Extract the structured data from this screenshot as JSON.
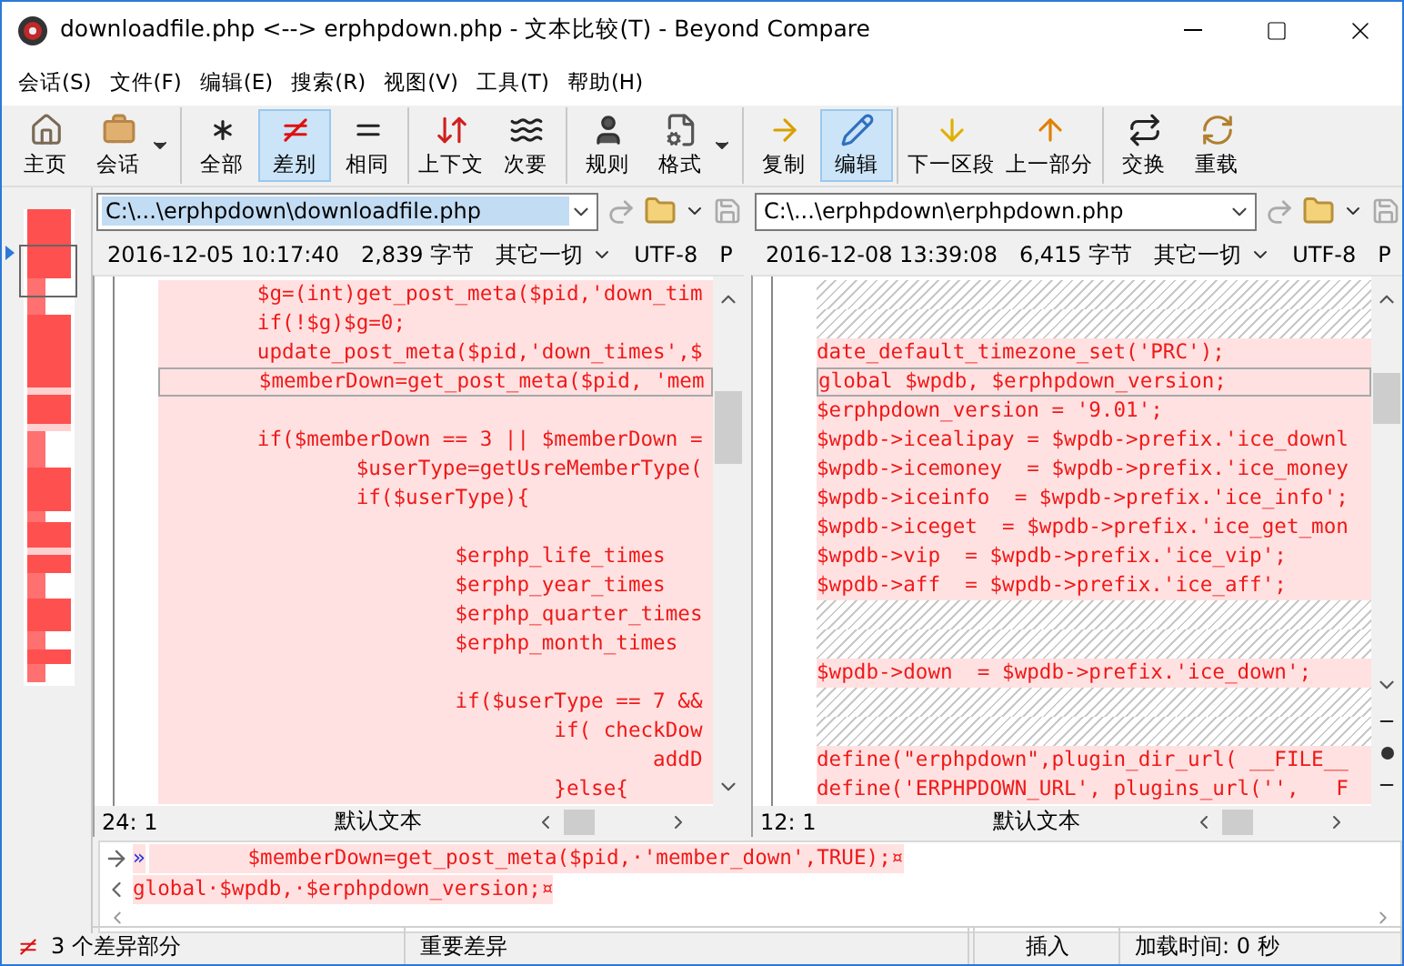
{
  "window": {
    "title": "downloadfile.php <--> erphpdown.php - 文本比较(T) - Beyond Compare"
  },
  "menu": [
    "会话(S)",
    "文件(F)",
    "编辑(E)",
    "搜索(R)",
    "视图(V)",
    "工具(T)",
    "帮助(H)"
  ],
  "toolbar": [
    [
      {
        "label": "主页",
        "selected": false,
        "dropdown": false
      },
      {
        "label": "会话",
        "selected": false,
        "dropdown": true
      }
    ],
    [
      {
        "label": "全部",
        "selected": false,
        "dropdown": false
      },
      {
        "label": "差别",
        "selected": true,
        "dropdown": false
      },
      {
        "label": "相同",
        "selected": false,
        "dropdown": false
      }
    ],
    [
      {
        "label": "上下文",
        "selected": false,
        "dropdown": false
      },
      {
        "label": "次要",
        "selected": false,
        "dropdown": false
      }
    ],
    [
      {
        "label": "规则",
        "selected": false,
        "dropdown": false
      },
      {
        "label": "格式",
        "selected": false,
        "dropdown": true
      }
    ],
    [
      {
        "label": "复制",
        "selected": false,
        "dropdown": false
      },
      {
        "label": "编辑",
        "selected": true,
        "dropdown": false
      }
    ],
    [
      {
        "label": "下一区段",
        "selected": false,
        "dropdown": false
      },
      {
        "label": "上一部分",
        "selected": false,
        "dropdown": false
      }
    ],
    [
      {
        "label": "交换",
        "selected": false,
        "dropdown": false
      },
      {
        "label": "重载",
        "selected": false,
        "dropdown": false
      }
    ]
  ],
  "panes": [
    {
      "path": "C:\\...\\erphpdown\\downloadfile.php",
      "path_selected": true,
      "date": "2016-12-05 10:17:40",
      "size": "2,839 字节",
      "filter": "其它一切",
      "encoding": "UTF-8",
      "line_end": "P",
      "position": "24: 1",
      "syntax": "默认文本",
      "lines": [
        {
          "kind": "diff",
          "text": "        $g=(int)get_post_meta($pid,'down_tim",
          "current": false
        },
        {
          "kind": "diff",
          "text": "        if(!$g)$g=0;",
          "current": false
        },
        {
          "kind": "diff",
          "text": "        update_post_meta($pid,'down_times',$",
          "current": false
        },
        {
          "kind": "diff",
          "text": "        $memberDown=get_post_meta($pid, 'mem",
          "current": true
        },
        {
          "kind": "blank",
          "current": false
        },
        {
          "kind": "diff",
          "text": "        if($memberDown == 3 || $memberDown =",
          "current": false
        },
        {
          "kind": "diff",
          "text": "                $userType=getUsreMemberType(",
          "current": false
        },
        {
          "kind": "diff",
          "text": "                if($userType){",
          "current": false
        },
        {
          "kind": "blank",
          "current": false
        },
        {
          "kind": "diff",
          "text": "                        $erphp_life_times",
          "current": false
        },
        {
          "kind": "diff",
          "text": "                        $erphp_year_times",
          "current": false
        },
        {
          "kind": "diff",
          "text": "                        $erphp_quarter_times",
          "current": false
        },
        {
          "kind": "diff",
          "text": "                        $erphp_month_times",
          "current": false
        },
        {
          "kind": "blank",
          "current": false
        },
        {
          "kind": "diff",
          "text": "                        if($userType == 7 &&",
          "current": false
        },
        {
          "kind": "diff",
          "text": "                                if( checkDow",
          "current": false
        },
        {
          "kind": "diff",
          "text": "                                        addD",
          "current": false
        },
        {
          "kind": "diff",
          "text": "                                }else{",
          "current": false
        }
      ]
    },
    {
      "path": "C:\\...\\erphpdown\\erphpdown.php",
      "path_selected": false,
      "date": "2016-12-08 13:39:08",
      "size": "6,415 字节",
      "filter": "其它一切",
      "encoding": "UTF-8",
      "line_end": "P",
      "position": "12: 1",
      "syntax": "默认文本",
      "lines": [
        {
          "kind": "missing",
          "current": false
        },
        {
          "kind": "missing",
          "current": false
        },
        {
          "kind": "diff",
          "text": "date_default_timezone_set('PRC');",
          "current": false
        },
        {
          "kind": "diff",
          "text": "global $wpdb, $erphpdown_version;",
          "current": true
        },
        {
          "kind": "diff",
          "text": "$erphpdown_version = '9.01';",
          "current": false
        },
        {
          "kind": "diff",
          "text": "$wpdb->icealipay = $wpdb->prefix.'ice_downl",
          "current": false
        },
        {
          "kind": "diff",
          "text": "$wpdb->icemoney  = $wpdb->prefix.'ice_money",
          "current": false
        },
        {
          "kind": "diff",
          "text": "$wpdb->iceinfo  = $wpdb->prefix.'ice_info';",
          "current": false
        },
        {
          "kind": "diff",
          "text": "$wpdb->iceget  = $wpdb->prefix.'ice_get_mon",
          "current": false
        },
        {
          "kind": "diff",
          "text": "$wpdb->vip  = $wpdb->prefix.'ice_vip';",
          "current": false
        },
        {
          "kind": "diff",
          "text": "$wpdb->aff  = $wpdb->prefix.'ice_aff';",
          "current": false
        },
        {
          "kind": "missing",
          "current": false
        },
        {
          "kind": "missing",
          "current": false
        },
        {
          "kind": "diff",
          "text": "$wpdb->down  = $wpdb->prefix.'ice_down';",
          "current": false
        },
        {
          "kind": "missing",
          "current": false
        },
        {
          "kind": "missing",
          "current": false
        },
        {
          "kind": "diff",
          "text": "define(\"erphpdown\",plugin_dir_url( __FILE__",
          "current": false
        },
        {
          "kind": "diff",
          "text": "define('ERPHPDOWN_URL', plugins_url('',   F",
          "current": false
        }
      ]
    }
  ],
  "detail": [
    {
      "kind": "right",
      "marker": "»",
      "text": "        $memberDown=get_post_meta($pid,·'member_down',TRUE);¤"
    },
    {
      "kind": "left",
      "text": "global·$wpdb,·$erphpdown_version;¤"
    }
  ],
  "status_bar": {
    "differences": "3 个差异部分",
    "filter": "重要差异",
    "mode": "插入",
    "load_time": "加载时间: 0 秒"
  }
}
